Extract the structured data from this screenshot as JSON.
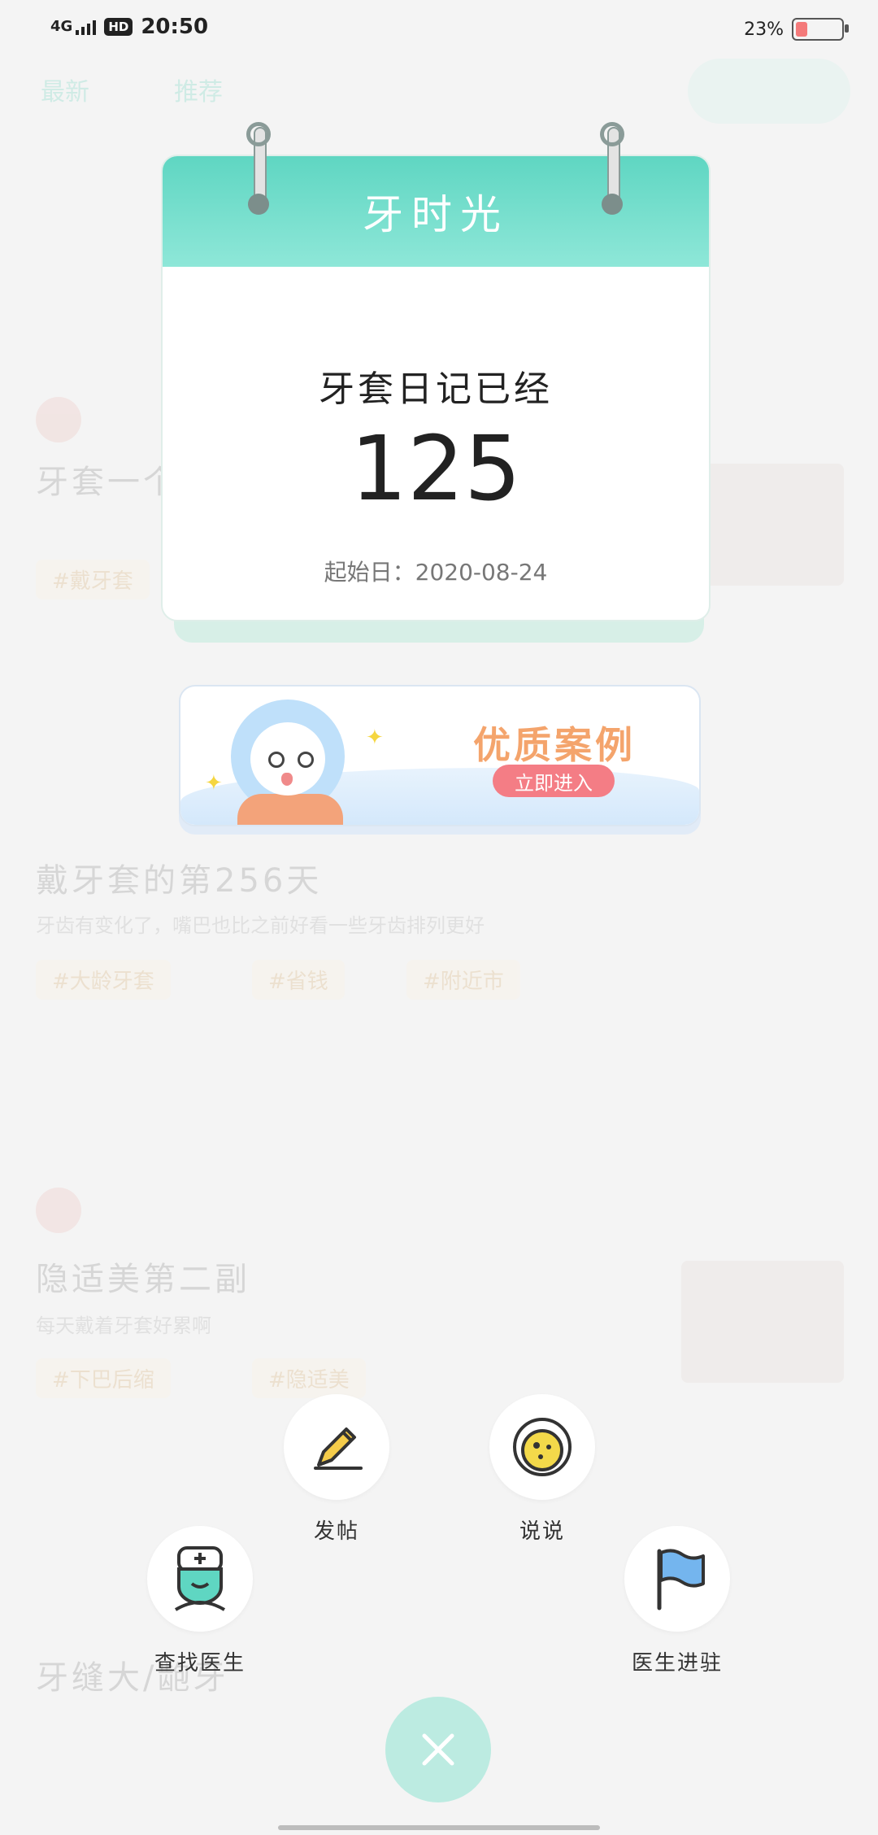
{
  "status_bar": {
    "network": "4G",
    "hd": "HD",
    "time": "20:50",
    "battery_pct": "23%",
    "battery_level": 0.23
  },
  "background_feed": {
    "tabs": [
      "最新",
      "推荐"
    ],
    "posts": [
      {
        "title": "牙套一个月",
        "tag": "#戴牙套"
      },
      {
        "title": "戴牙套的第256天",
        "subtitle": "牙齿有变化了，嘴巴也比之前好看一些牙齿排列更好",
        "tags": [
          "#大龄牙套",
          "#省钱",
          "#附近市"
        ]
      },
      {
        "title": "隐适美第二副",
        "subtitle": "每天戴着牙套好累啊",
        "tags": [
          "#下巴后缩",
          "#隐适美"
        ]
      },
      {
        "title": "牙缝大/龅牙"
      }
    ]
  },
  "calendar": {
    "header": "牙时光",
    "label": "牙套日记已经",
    "days": "125",
    "start_date": "起始日：2020-08-24"
  },
  "banner": {
    "title": "优质案例",
    "button": "立即进入"
  },
  "actions": {
    "post": "发帖",
    "talk": "说说",
    "find_doctor": "查找医生",
    "doctor_join": "医生进驻"
  },
  "colors": {
    "accent": "#5fd6c2",
    "close_button": "#bcebe1",
    "banner_title": "#f4a46c",
    "banner_button": "#f47d85"
  },
  "icons": {
    "post": "pencil-icon",
    "talk": "speech-face-icon",
    "find_doctor": "nurse-icon",
    "doctor_join": "flag-icon",
    "close": "close-icon"
  }
}
